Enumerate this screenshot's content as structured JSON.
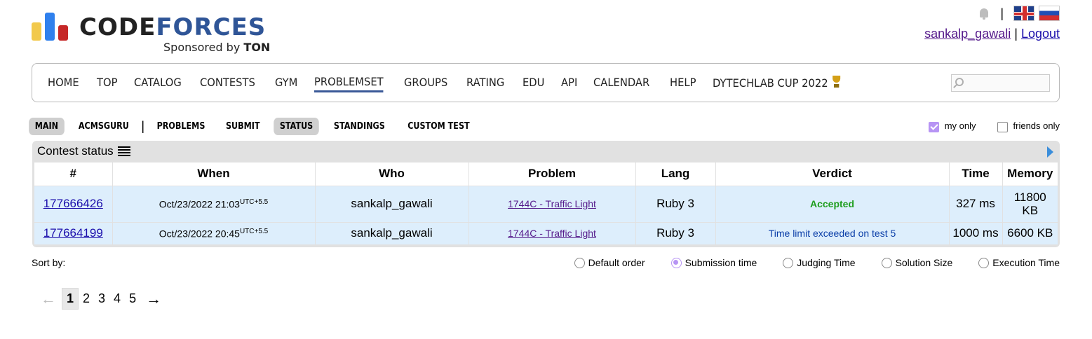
{
  "logo": {
    "word_code": "CODE",
    "word_forces": "FORCES",
    "sponsor_prefix": "Sponsored by",
    "sponsor_name": "TON"
  },
  "header": {
    "separator": "|",
    "user": "sankalp_gawali",
    "user_sep": "|",
    "logout": "Logout"
  },
  "menu": [
    "HOME",
    "TOP",
    "CATALOG",
    "CONTESTS",
    "GYM",
    "PROBLEMSET",
    "GROUPS",
    "RATING",
    "EDU",
    "API",
    "CALENDAR",
    "HELP",
    "DYTECHLAB CUP 2022"
  ],
  "search": {
    "placeholder": ""
  },
  "submenu": {
    "main": "MAIN",
    "acmsguru": "ACMSGURU",
    "sep": "|",
    "problems": "PROBLEMS",
    "submit": "SUBMIT",
    "status": "STATUS",
    "standings": "STANDINGS",
    "custom_test": "CUSTOM TEST"
  },
  "filters": {
    "my_only": "my only",
    "friends_only": "friends only"
  },
  "status": {
    "title": "Contest status",
    "columns": [
      "#",
      "When",
      "Who",
      "Problem",
      "Lang",
      "Verdict",
      "Time",
      "Memory"
    ],
    "rows": [
      {
        "id": "177666426",
        "when": "Oct/23/2022 21:03",
        "tz": "UTC+5.5",
        "who": "sankalp_gawali",
        "problem": "1744C - Traffic Light",
        "lang": "Ruby 3",
        "verdict": "Accepted",
        "time": "327 ms",
        "memory_1": "11800",
        "memory_2": "KB"
      },
      {
        "id": "177664199",
        "when": "Oct/23/2022 20:45",
        "tz": "UTC+5.5",
        "who": "sankalp_gawali",
        "problem": "1744C - Traffic Light",
        "lang": "Ruby 3",
        "verdict": "Time limit exceeded on test 5",
        "time": "1000 ms",
        "memory": "6600 KB"
      }
    ]
  },
  "sort": {
    "label": "Sort by:",
    "options": [
      "Default order",
      "Submission time",
      "Judging Time",
      "Solution Size",
      "Execution Time"
    ],
    "selected": "Submission time"
  },
  "pagination": {
    "prev": "←",
    "pages": [
      "1",
      "2",
      "3",
      "4",
      "5"
    ],
    "current": "1",
    "next": "→"
  },
  "colors": {
    "accent": "#3b5998",
    "accepted": "#1f9e1f",
    "row_bg": "#ddeefc",
    "check": "#b794f4"
  }
}
